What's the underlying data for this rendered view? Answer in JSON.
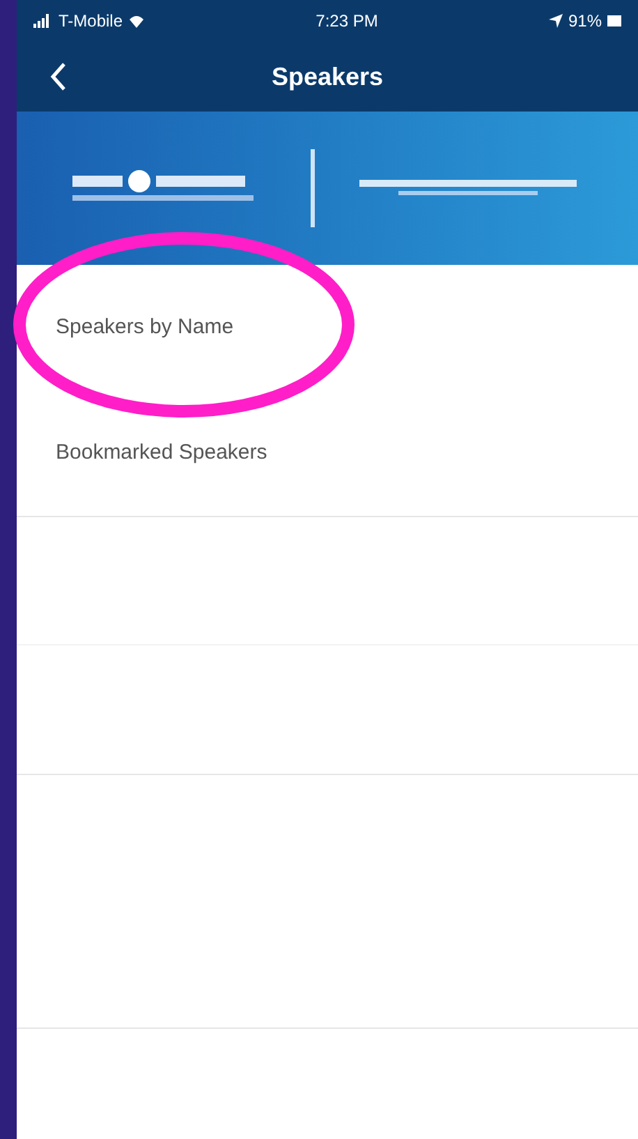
{
  "status_bar": {
    "carrier": "T-Mobile",
    "time": "7:23 PM",
    "battery": "91%"
  },
  "nav": {
    "title": "Speakers"
  },
  "menu": {
    "items": [
      {
        "label": "Speakers by Name",
        "circled": true
      },
      {
        "label": "Bookmarked Speakers",
        "circled": false
      }
    ]
  }
}
